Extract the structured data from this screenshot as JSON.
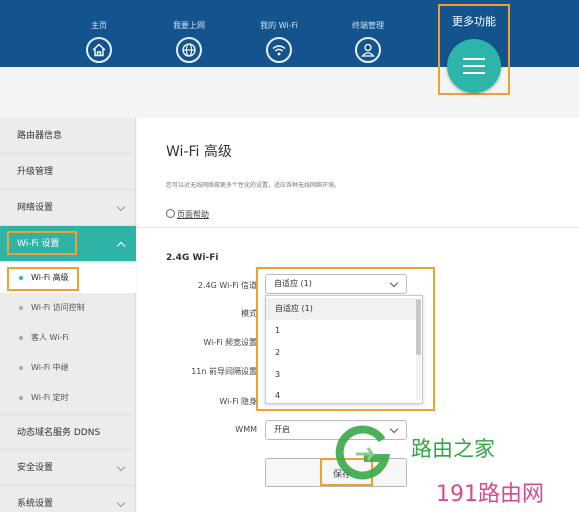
{
  "header": {
    "nav": [
      {
        "label": "主页",
        "icon": "home-icon"
      },
      {
        "label": "我要上网",
        "icon": "globe-icon"
      },
      {
        "label": "我的 Wi-Fi",
        "icon": "wifi-icon"
      },
      {
        "label": "终端管理",
        "icon": "user-icon"
      }
    ],
    "more_label": "更多功能",
    "more_icon": "menu-icon"
  },
  "sidebar": {
    "items": [
      {
        "label": "路由器信息"
      },
      {
        "label": "升级管理"
      },
      {
        "label": "网络设置"
      },
      {
        "label": "Wi-Fi 设置"
      },
      {
        "label": "动态域名服务 DDNS"
      },
      {
        "label": "安全设置"
      },
      {
        "label": "系统设置"
      }
    ],
    "sub_items": [
      {
        "label": "Wi-Fi 高级"
      },
      {
        "label": "Wi-Fi 访问控制"
      },
      {
        "label": "客人 Wi-Fi"
      },
      {
        "label": "Wi-Fi 中继"
      },
      {
        "label": "Wi-Fi 定时"
      }
    ]
  },
  "main": {
    "title": "Wi-Fi 高级",
    "description": "您可以对无线网络做更多个性化的设置，适应各种无线网络环境。",
    "help_link": "页面帮助",
    "section": "2.4G Wi-Fi",
    "fields": {
      "channel_label": "2.4G Wi-Fi 信道",
      "channel_value": "自适应 (1)",
      "mode_label": "模式",
      "bandwidth_label": "Wi-Fi 频宽设置",
      "guard_label": "11n 前导间隔设置",
      "hide_label": "Wi-Fi 隐身",
      "wmm_label": "WMM",
      "wmm_value": "开启"
    },
    "dropdown_options": [
      "自适应 (1)",
      "1",
      "2",
      "3",
      "4"
    ],
    "save_label": "保存"
  },
  "watermark": {
    "line1": "路由之家",
    "line2": "191路由网"
  },
  "colors": {
    "header": "#14548e",
    "accent": "#2fb3a6",
    "highlight": "#f0a030"
  }
}
